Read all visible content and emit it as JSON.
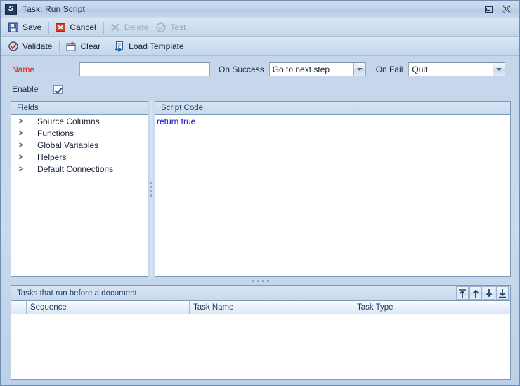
{
  "window": {
    "title": "Task: Run Script",
    "app_icon": "script-app-icon",
    "restore_label": "Restore",
    "close_label": "Close"
  },
  "toolbar_primary": [
    {
      "label": "Save",
      "icon": "save-icon",
      "enabled": true
    },
    {
      "label": "Cancel",
      "icon": "cancel-icon",
      "enabled": true
    },
    {
      "label": "Delete",
      "icon": "delete-icon",
      "enabled": false
    },
    {
      "label": "Test",
      "icon": "test-icon",
      "enabled": false
    }
  ],
  "toolbar_secondary": [
    {
      "label": "Validate",
      "icon": "validate-icon",
      "enabled": true
    },
    {
      "label": "Clear",
      "icon": "clear-icon",
      "enabled": true
    },
    {
      "label": "Load Template",
      "icon": "load-template-icon",
      "enabled": true
    }
  ],
  "form": {
    "name_label": "Name",
    "name_value": "",
    "name_placeholder": "",
    "enable_label": "Enable",
    "enable_checked": true,
    "on_success_label": "On Success",
    "on_success_value": "Go to next step",
    "on_fail_label": "On Fail",
    "on_fail_value": "Quit"
  },
  "fields_pane": {
    "header": "Fields",
    "items": [
      {
        "label": "Source Columns",
        "expander": ">"
      },
      {
        "label": "Functions",
        "expander": ">"
      },
      {
        "label": "Global Variables",
        "expander": ">"
      },
      {
        "label": "Helpers",
        "expander": ">"
      },
      {
        "label": "Default Connections",
        "expander": ">"
      }
    ]
  },
  "script_pane": {
    "header": "Script Code",
    "code": "return true"
  },
  "bottom_pane": {
    "header": "Tasks that run before a document",
    "move_buttons": [
      {
        "name": "move-to-top-button",
        "glyph": "⤒"
      },
      {
        "name": "move-up-button",
        "glyph": "↑"
      },
      {
        "name": "move-down-button",
        "glyph": "↓"
      },
      {
        "name": "move-to-bottom-button",
        "glyph": "⤓"
      }
    ],
    "columns": [
      "Sequence",
      "Task Name",
      "Task Type"
    ],
    "rows": []
  },
  "colors": {
    "accent": "#1a3a5f",
    "required": "#e02020",
    "code_text": "#0c0ccb",
    "window_bg": "#c5d6ea"
  }
}
